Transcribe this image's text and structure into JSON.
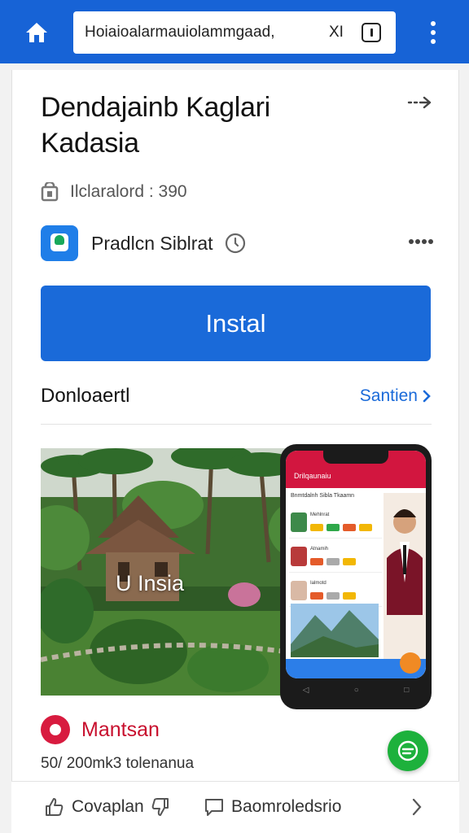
{
  "browser": {
    "url_text": "Hoiaioalarmauiolammgaad,",
    "url_suffix": "XI"
  },
  "app": {
    "title": "Dendajainb Kaglari Kadasia",
    "meta": "Ilclaralord : 390",
    "developer": "Pradlcn Siblrat",
    "install_label": "Instal"
  },
  "section": {
    "title": "Donloaertl",
    "link": "Santien"
  },
  "hero": {
    "overlay_text": "U  Insia",
    "phone": {
      "header_text": "Drilqaunaiu",
      "search_text": "Bnmtdalnh Sibla Tkaamn",
      "items": [
        "Mehlnrat",
        "Atnamih",
        "Ialmotd"
      ]
    }
  },
  "brand": {
    "name": "Mantsan",
    "subtitle": "50/ 200mk3 tolenanua"
  },
  "bottom": {
    "item1": "Covaplan",
    "item2": "Baomroledsrio"
  },
  "colors": {
    "accent_blue": "#1a6ad9",
    "topbar_blue": "#1763d6",
    "brand_red": "#c8102e",
    "chat_green": "#1db13c"
  },
  "icons": [
    "home-icon",
    "tabs-icon",
    "menu-icon",
    "share-icon",
    "lock-icon",
    "clock-icon",
    "more-icon",
    "chevron-right-icon",
    "thumbs-up-icon",
    "thumbs-down-icon",
    "comment-icon",
    "chat-icon"
  ]
}
